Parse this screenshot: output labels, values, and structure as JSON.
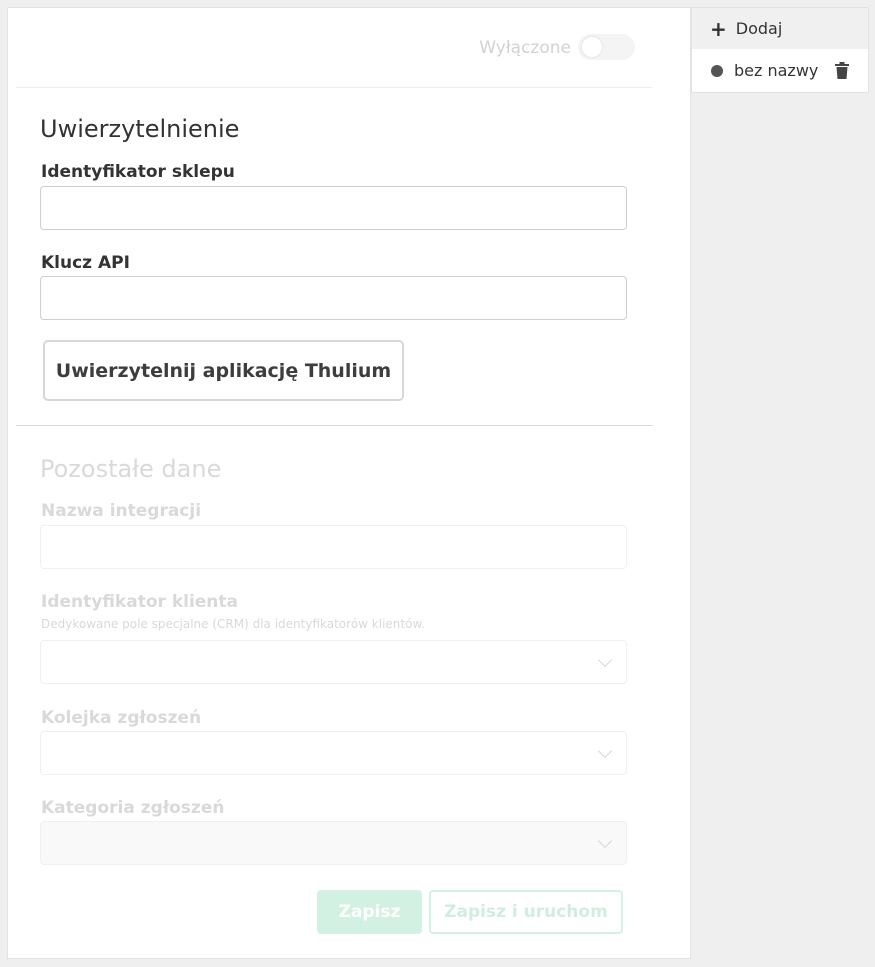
{
  "status": {
    "toggle_label": "Wyłączone",
    "toggle_on": false
  },
  "auth": {
    "title": "Uwierzytelnienie",
    "shop_id_label": "Identyfikator sklepu",
    "shop_id_value": "",
    "api_key_label": "Klucz API",
    "api_key_value": "",
    "auth_button": "Uwierzytelnij aplikację Thulium"
  },
  "other": {
    "title": "Pozostałe dane",
    "integration_name_label": "Nazwa integracji",
    "integration_name_value": "",
    "client_id_label": "Identyfikator klienta",
    "client_id_hint": "Dedykowane pole specjalne (CRM) dla identyfikatorów klientów.",
    "client_id_value": "",
    "queue_label": "Kolejka zgłoszeń",
    "queue_value": "",
    "category_label": "Kategoria zgłoszeń",
    "category_value": ""
  },
  "actions": {
    "save": "Zapisz",
    "save_and_run": "Zapisz i uruchom"
  },
  "sidebar": {
    "add_label": "Dodaj",
    "items": [
      {
        "label": "bez nazwy"
      }
    ]
  },
  "colors": {
    "accent_disabled": "#d2f1e3",
    "background": "#efefef"
  }
}
